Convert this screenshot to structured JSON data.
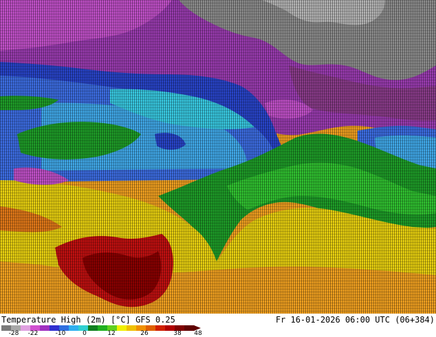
{
  "footer": {
    "title_left": "Temperature High (2m) [°C] GFS 0.25",
    "title_right": "Fr 16-01-2026 06:00 UTC (06+384)"
  },
  "colorbar": {
    "ticks": [
      "-28",
      "-22",
      "-10",
      "0",
      "12",
      "26",
      "38",
      "48"
    ],
    "colors": [
      "#7a7a7a",
      "#a8a8a8",
      "#e0a0e0",
      "#d050d0",
      "#a030c0",
      "#3030d0",
      "#3070e0",
      "#30b0f0",
      "#30d0d0",
      "#108020",
      "#20b020",
      "#60d020",
      "#f0f000",
      "#f0c000",
      "#f09000",
      "#e06000",
      "#d02000",
      "#b00000",
      "#800000",
      "#600000"
    ]
  },
  "map": {
    "palette": {
      "polar_gray": "#8c8c8c",
      "polar_light": "#b4b4b4",
      "arctic_violet": "#8a3c8a",
      "magenta": "#c050c8",
      "purple": "#9a3cb0",
      "deep_blue": "#2844c8",
      "mid_blue": "#3c6ce0",
      "light_blue": "#40a8e8",
      "cyan": "#38c8e0",
      "green": "#1e9c28",
      "bright_green": "#30c030",
      "yellow": "#e8d010",
      "orange": "#f0a020",
      "dark_orange": "#e07818",
      "red": "#c01010",
      "dark_red": "#8a0000"
    }
  }
}
